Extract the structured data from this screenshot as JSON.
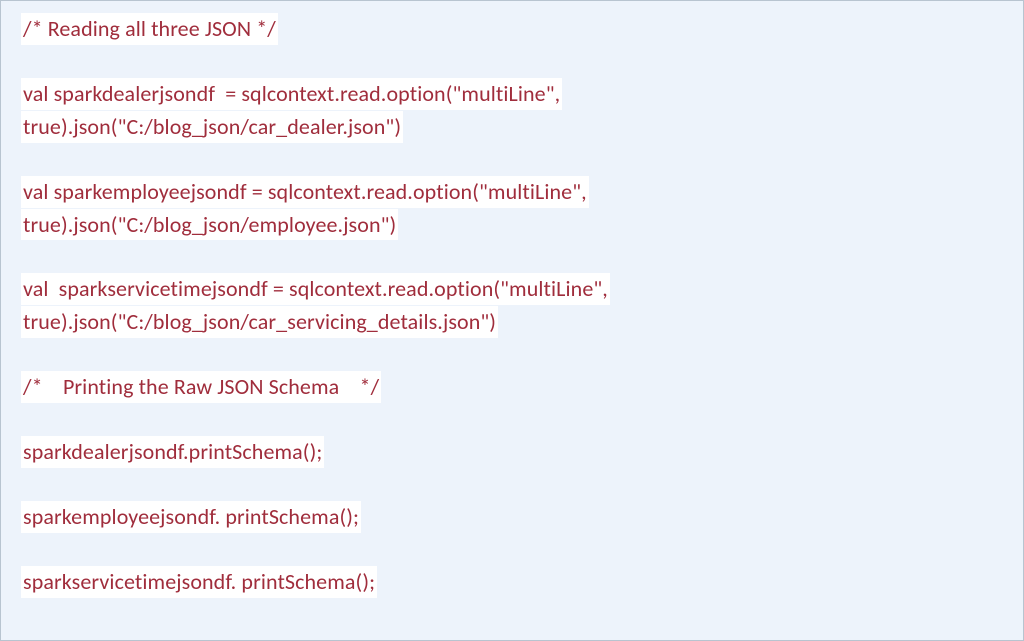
{
  "code": {
    "line01": "/* Reading all three JSON */",
    "line02": "val sparkdealerjsondf  = sqlcontext.read.option(\"multiLine\",",
    "line03": "true).json(\"C:/blog_json/car_dealer.json\")",
    "line04": "val sparkemployeejsondf = sqlcontext.read.option(\"multiLine\",",
    "line05": "true).json(\"C:/blog_json/employee.json\")",
    "line06": "val  sparkservicetimejsondf = sqlcontext.read.option(\"multiLine\",",
    "line07": "true).json(\"C:/blog_json/car_servicing_details.json\")",
    "line08": "/*    Printing the Raw JSON Schema    */",
    "line09": "sparkdealerjsondf.printSchema();",
    "line10": "sparkemployeejsondf. printSchema();",
    "line11": "sparkservicetimejsondf. printSchema();"
  }
}
